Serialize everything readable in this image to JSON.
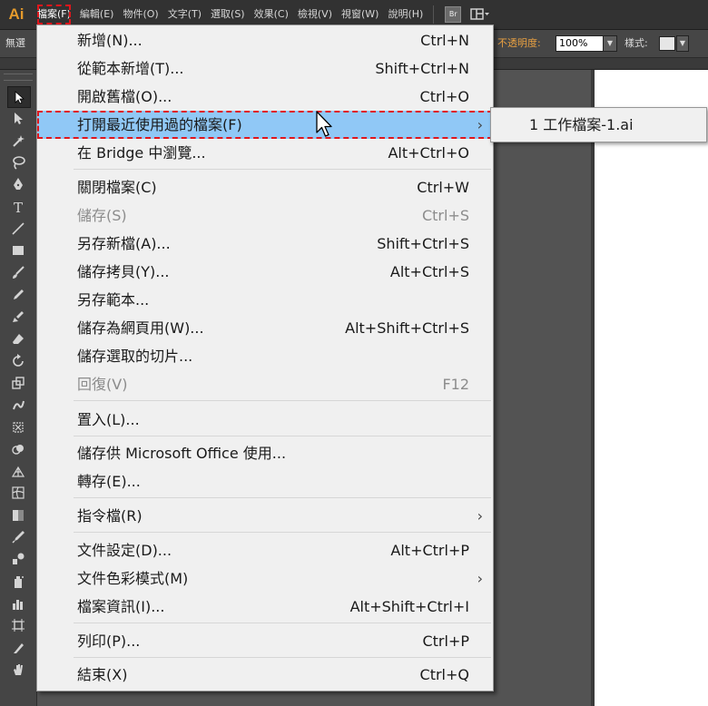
{
  "menubar": {
    "logo": "Ai",
    "items": [
      {
        "label": "檔案(F)"
      },
      {
        "label": "編輯(E)"
      },
      {
        "label": "物件(O)"
      },
      {
        "label": "文字(T)"
      },
      {
        "label": "選取(S)"
      },
      {
        "label": "效果(C)"
      },
      {
        "label": "檢視(V)"
      },
      {
        "label": "視窗(W)"
      },
      {
        "label": "說明(H)"
      }
    ],
    "bridge_label": "Br"
  },
  "controlbar": {
    "left_label": "無選",
    "opacity_label": "不透明度:",
    "opacity_value": "100%",
    "style_label": "樣式:"
  },
  "file_menu": {
    "items": [
      {
        "label": "新增(N)...",
        "shortcut": "Ctrl+N"
      },
      {
        "label": "從範本新增(T)...",
        "shortcut": "Shift+Ctrl+N"
      },
      {
        "label": "開啟舊檔(O)...",
        "shortcut": "Ctrl+O"
      },
      {
        "label": "打開最近使用過的檔案(F)",
        "shortcut": "",
        "arrow": "›"
      },
      {
        "label": "在 Bridge 中瀏覽...",
        "shortcut": "Alt+Ctrl+O"
      },
      {
        "label": "關閉檔案(C)",
        "shortcut": "Ctrl+W"
      },
      {
        "label": "儲存(S)",
        "shortcut": "Ctrl+S"
      },
      {
        "label": "另存新檔(A)...",
        "shortcut": "Shift+Ctrl+S"
      },
      {
        "label": "儲存拷貝(Y)...",
        "shortcut": "Alt+Ctrl+S"
      },
      {
        "label": "另存範本...",
        "shortcut": ""
      },
      {
        "label": "儲存為網頁用(W)...",
        "shortcut": "Alt+Shift+Ctrl+S"
      },
      {
        "label": "儲存選取的切片...",
        "shortcut": ""
      },
      {
        "label": "回復(V)",
        "shortcut": "F12"
      },
      {
        "label": "置入(L)...",
        "shortcut": ""
      },
      {
        "label": "儲存供 Microsoft Office 使用...",
        "shortcut": ""
      },
      {
        "label": "轉存(E)...",
        "shortcut": ""
      },
      {
        "label": "指令檔(R)",
        "shortcut": "",
        "arrow": "›"
      },
      {
        "label": "文件設定(D)...",
        "shortcut": "Alt+Ctrl+P"
      },
      {
        "label": "文件色彩模式(M)",
        "shortcut": "",
        "arrow": "›"
      },
      {
        "label": "檔案資訊(I)...",
        "shortcut": "Alt+Shift+Ctrl+I"
      },
      {
        "label": "列印(P)...",
        "shortcut": "Ctrl+P"
      },
      {
        "label": "結束(X)",
        "shortcut": "Ctrl+Q"
      }
    ]
  },
  "recent_submenu": {
    "items": [
      {
        "label": "1  工作檔案-1.ai"
      }
    ]
  },
  "icons": {
    "tools": [
      "selection-tool-icon",
      "direct-selection-tool-icon",
      "magic-wand-tool-icon",
      "lasso-tool-icon",
      "pen-tool-icon",
      "type-tool-icon",
      "line-tool-icon",
      "rectangle-tool-icon",
      "paintbrush-tool-icon",
      "pencil-tool-icon",
      "blob-brush-tool-icon",
      "eraser-tool-icon",
      "rotate-tool-icon",
      "scale-tool-icon",
      "warp-tool-icon",
      "free-transform-tool-icon",
      "shape-builder-tool-icon",
      "perspective-grid-tool-icon",
      "mesh-tool-icon",
      "gradient-tool-icon",
      "eyedropper-tool-icon",
      "blend-tool-icon",
      "symbol-sprayer-tool-icon",
      "column-graph-tool-icon",
      "artboard-tool-icon",
      "slice-tool-icon",
      "hand-tool-icon"
    ]
  },
  "colors": {
    "highlight": "#90c8f6",
    "annotation": "#e0161c",
    "logo": "#e49a2c"
  }
}
